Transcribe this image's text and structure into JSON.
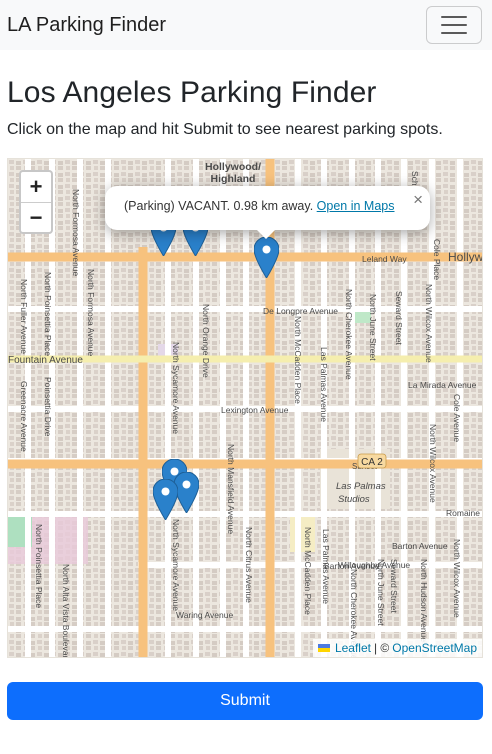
{
  "navbar": {
    "brand": "LA Parking Finder",
    "toggle_icon": "hamburger-menu-icon"
  },
  "page": {
    "title": "Los Angeles Parking Finder",
    "subtitle": "Click on the map and hit Submit to see nearest parking spots."
  },
  "map": {
    "zoom_in": "+",
    "zoom_out": "−",
    "popup": {
      "text": "(Parking) VACANT. 0.98 km away.",
      "link": "Open in Maps",
      "close": "×"
    },
    "attribution": {
      "leaflet": "Leaflet",
      "separator": "| ©",
      "osm": "OpenStreetMap"
    },
    "labels": {
      "hollywood_highland_1": "Hollywood/",
      "hollywood_highland_2": "Highland",
      "holly": "Hollyw",
      "fountain": "Fountain Avenue",
      "lexington": "Lexington Avenue",
      "de_longpre": "De Longpre Avenue",
      "leland": "Leland Way",
      "la_mirada": "La Mirada Avenue",
      "ca2": "CA 2",
      "sunset_1": "Sunset",
      "sunset_2": "Las Palmas",
      "sunset_3": "Studios",
      "barton": "Barton Avenue",
      "willoughby": "Willoughby Avenue",
      "waring": "Waring Avenue",
      "romaine": "Romaine S",
      "n_fuller": "North Fuller Avenue",
      "n_poinsettia": "North Poinsettia Place",
      "poinsettia_dr": "Poinsettia Drive",
      "n_formosa": "North Formosa Avenue",
      "greenacre": "Greenacre Avenue",
      "n_orange": "North Orange Drive",
      "n_sycamore": "North Sycamore Avenue",
      "n_mansfield": "North Mansfield Avenue",
      "n_citrus": "North Citrus Avenue",
      "n_mccadden": "North McCadden Place",
      "las_palmas": "Las Palmas Avenue",
      "n_cherokee": "North Cherokee Avenue",
      "n_june": "North June Street",
      "seward": "Seward Street",
      "n_wilcox": "North Wilcox Avenue",
      "cole": "Cole Avenue",
      "n_hudson": "North Hudson Avenue",
      "n_alta_vista": "North Alta Vista Boulevard",
      "schr": "Schr",
      "cole_place": "Cole Place"
    }
  },
  "submit": {
    "label": "Submit"
  },
  "colors": {
    "primary": "#0d6efd",
    "marker": "#2a81cb",
    "major_road": "#f7c27e",
    "minor_road": "#ffffff"
  }
}
